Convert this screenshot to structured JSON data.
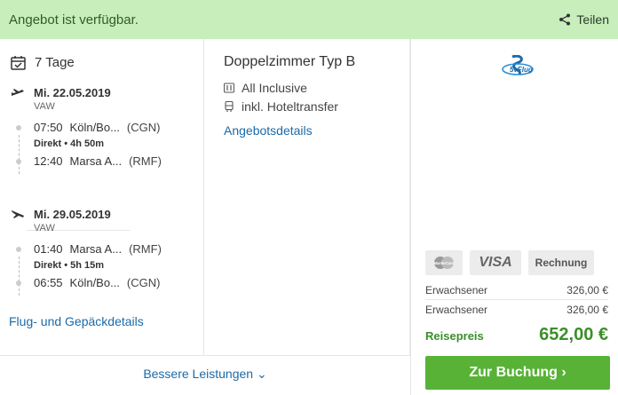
{
  "topbar": {
    "status": "Angebot ist verfügbar.",
    "share_label": "Teilen",
    "share_icon": "share-icon"
  },
  "left": {
    "days": "7 Tage",
    "outbound": {
      "date": "Mi. 22.05.2019",
      "airline": "VAW",
      "dep_time": "07:50",
      "dep_place": "Köln/Bo...",
      "dep_code": "(CGN)",
      "info": "Direkt  •  4h 50m",
      "arr_time": "12:40",
      "arr_place": "Marsa A...",
      "arr_code": "(RMF)"
    },
    "inbound": {
      "date": "Mi. 29.05.2019",
      "airline": "VAW",
      "dep_time": "01:40",
      "dep_place": "Marsa A...",
      "dep_code": "(RMF)",
      "info": "Direkt  •  5h 15m",
      "arr_time": "06:55",
      "arr_place": "Köln/Bo...",
      "arr_code": "(CGN)"
    },
    "details_link": "Flug- und Gepäckdetails"
  },
  "mid": {
    "room": "Doppelzimmer Typ B",
    "board": "All Inclusive",
    "transfer": "inkl. Hoteltransfer",
    "details_link": "Angebotsdetails"
  },
  "right": {
    "payment": {
      "mastercard": "MasterCard",
      "visa": "VISA",
      "invoice": "Rechnung"
    },
    "prices": [
      {
        "label": "Erwachsener",
        "value": "326,00 €"
      },
      {
        "label": "Erwachsener",
        "value": "326,00 €"
      }
    ],
    "total_label": "Reisepreis",
    "total_value": "652,00 €",
    "book_label": "Zur Buchung ›"
  },
  "bottom": {
    "better_label": "Bessere Leistungen  ⌄"
  },
  "colors": {
    "accent": "#57b236",
    "link": "#1b6aa8",
    "banner": "#c8eebb"
  }
}
